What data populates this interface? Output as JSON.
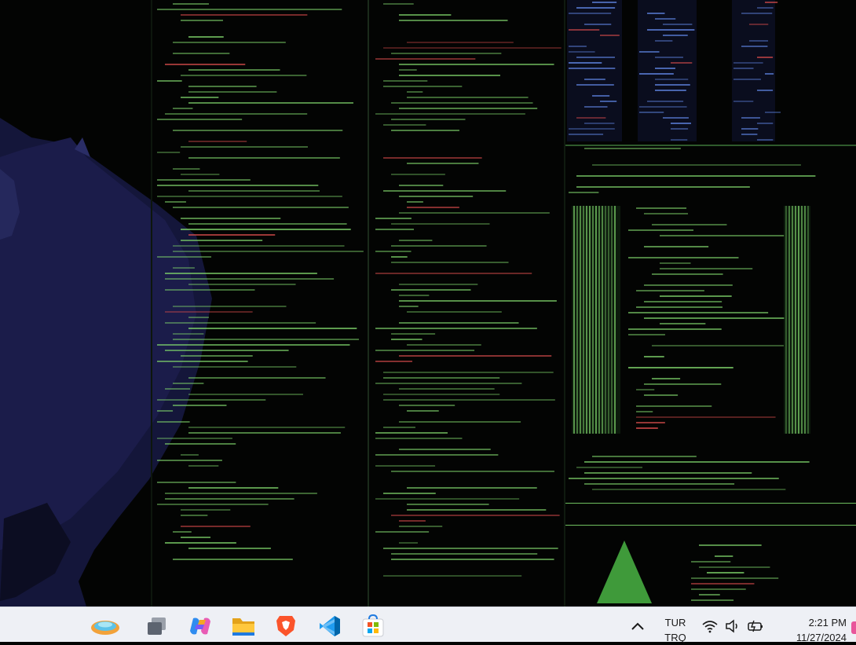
{
  "desktop": {
    "wallpaper": "dark code/terminal wallpaper with anime character",
    "colors": {
      "code_green": "#7fd46b",
      "code_blue": "#5b7fd9",
      "character_blue": "#1b1c46"
    }
  },
  "taskbar": {
    "apps": [
      {
        "name": "widgets",
        "icon": "widgets-icon"
      },
      {
        "name": "task-view",
        "icon": "task-view-icon"
      },
      {
        "name": "copilot",
        "icon": "copilot-icon"
      },
      {
        "name": "file-explorer",
        "icon": "folder-icon"
      },
      {
        "name": "brave",
        "icon": "brave-icon"
      },
      {
        "name": "vscode",
        "icon": "vscode-icon"
      },
      {
        "name": "microsoft-store",
        "icon": "store-icon"
      }
    ],
    "tray": {
      "language_line1": "TUR",
      "language_line2": "TRQ",
      "time": "2:21 PM",
      "date": "11/27/2024"
    },
    "background": "#eef0f5"
  }
}
